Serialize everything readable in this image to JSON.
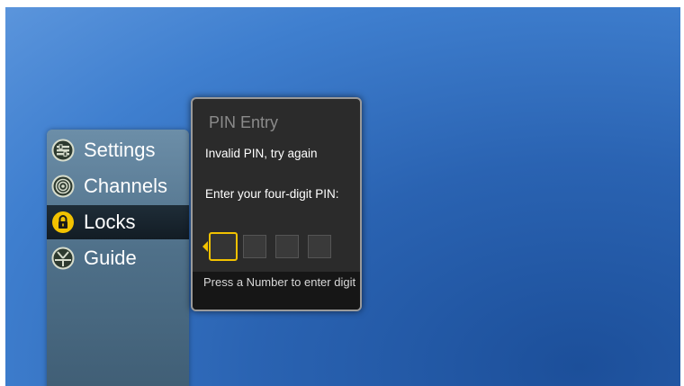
{
  "menu": {
    "items": [
      {
        "label": "Settings",
        "icon": "settings-icon",
        "selected": false
      },
      {
        "label": "Channels",
        "icon": "channels-icon",
        "selected": false
      },
      {
        "label": "Locks",
        "icon": "lock-icon",
        "selected": true
      },
      {
        "label": "Guide",
        "icon": "guide-icon",
        "selected": false
      }
    ]
  },
  "pin_dialog": {
    "title": "PIN Entry",
    "message": "Invalid PIN, try again",
    "prompt": "Enter your four-digit PIN:",
    "hint": "Press a Number to enter digit",
    "digit_count": 4,
    "active_index": 0
  },
  "colors": {
    "accent": "#f2c200",
    "background": "#2a63b2"
  }
}
